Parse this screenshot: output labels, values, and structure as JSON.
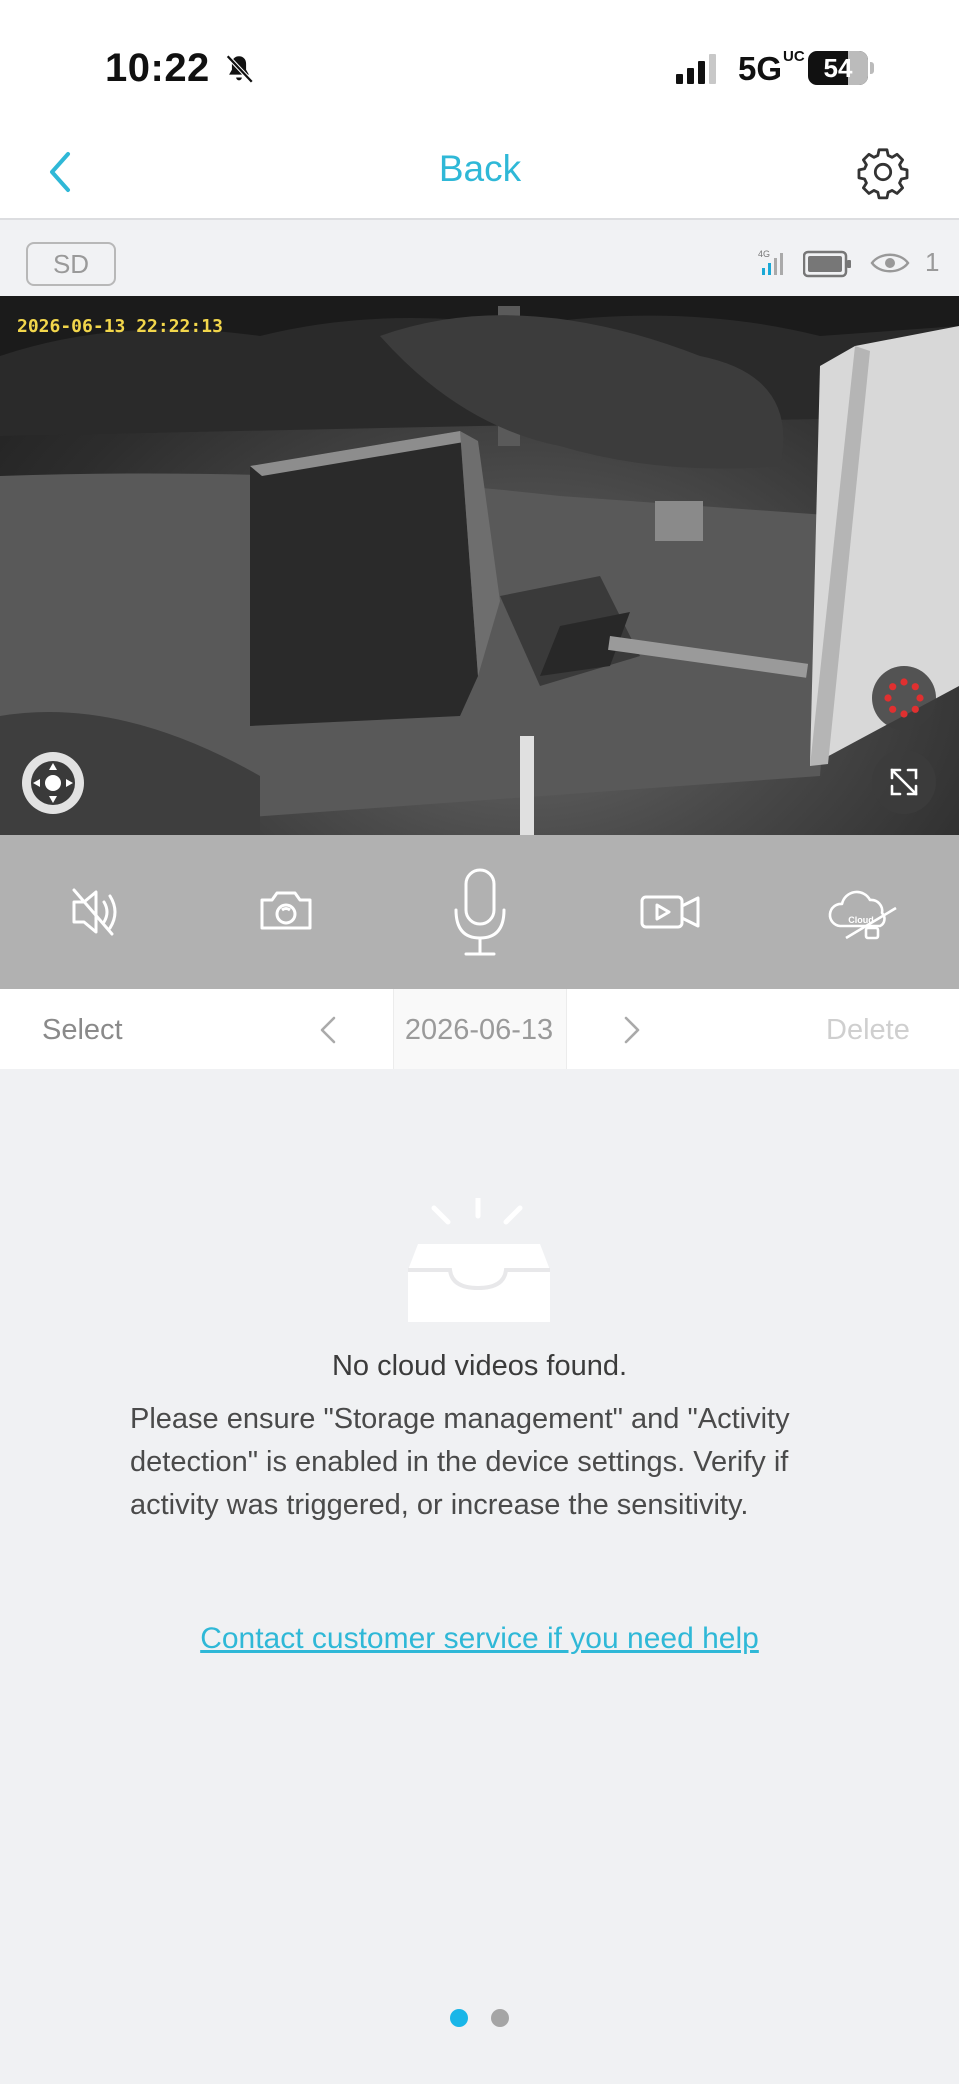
{
  "status_bar": {
    "time": "10:22",
    "network": "5G",
    "network_suffix": "UC",
    "battery": "54"
  },
  "header": {
    "back_label": "Back",
    "title": "Back"
  },
  "camera": {
    "storage_badge": "SD",
    "viewer_count": "1",
    "timestamp": "2026-06-13 22:22:13"
  },
  "controls": [
    "mute",
    "snapshot",
    "talk",
    "record",
    "cloud"
  ],
  "cloud_badge": "Cloud",
  "date_bar": {
    "select_label": "Select",
    "date": "2026-06-13",
    "delete_label": "Delete"
  },
  "empty_state": {
    "title": "No cloud videos found.",
    "description": "Please ensure \"Storage management\" and \"Activity detection\" is enabled in the device settings. Verify if activity was triggered, or increase the sensitivity.",
    "help_link": "Contact customer service if you need help"
  },
  "pagination": {
    "current": 1,
    "total": 2
  },
  "colors": {
    "accent": "#2fb8d7",
    "dot_active": "#19b6e8",
    "timestamp": "#f2d64b"
  }
}
